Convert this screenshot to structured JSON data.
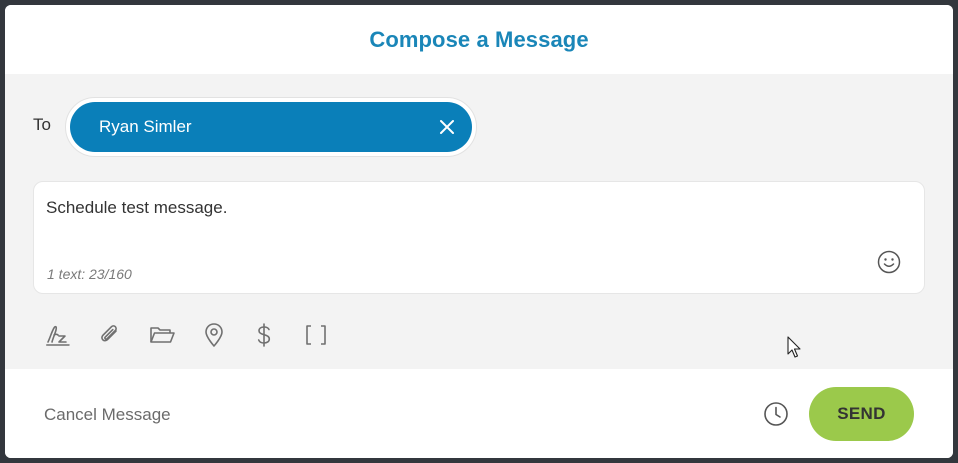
{
  "header": {
    "title": "Compose a Message"
  },
  "recipients": {
    "label": "To",
    "chips": [
      {
        "name": "Ryan Simler"
      }
    ]
  },
  "message": {
    "text": "Schedule test message.",
    "counter": "1 text: 23/160"
  },
  "toolbar": {
    "icons": [
      "signature-icon",
      "paperclip-icon",
      "folder-icon",
      "location-pin-icon",
      "dollar-icon",
      "brackets-icon"
    ]
  },
  "footer": {
    "cancel_label": "Cancel Message",
    "send_label": "SEND"
  },
  "colors": {
    "brand_blue": "#0a7fb9",
    "title_blue": "#1a86b8",
    "send_green": "#9bc94b",
    "panel_gray": "#f3f3f3"
  }
}
